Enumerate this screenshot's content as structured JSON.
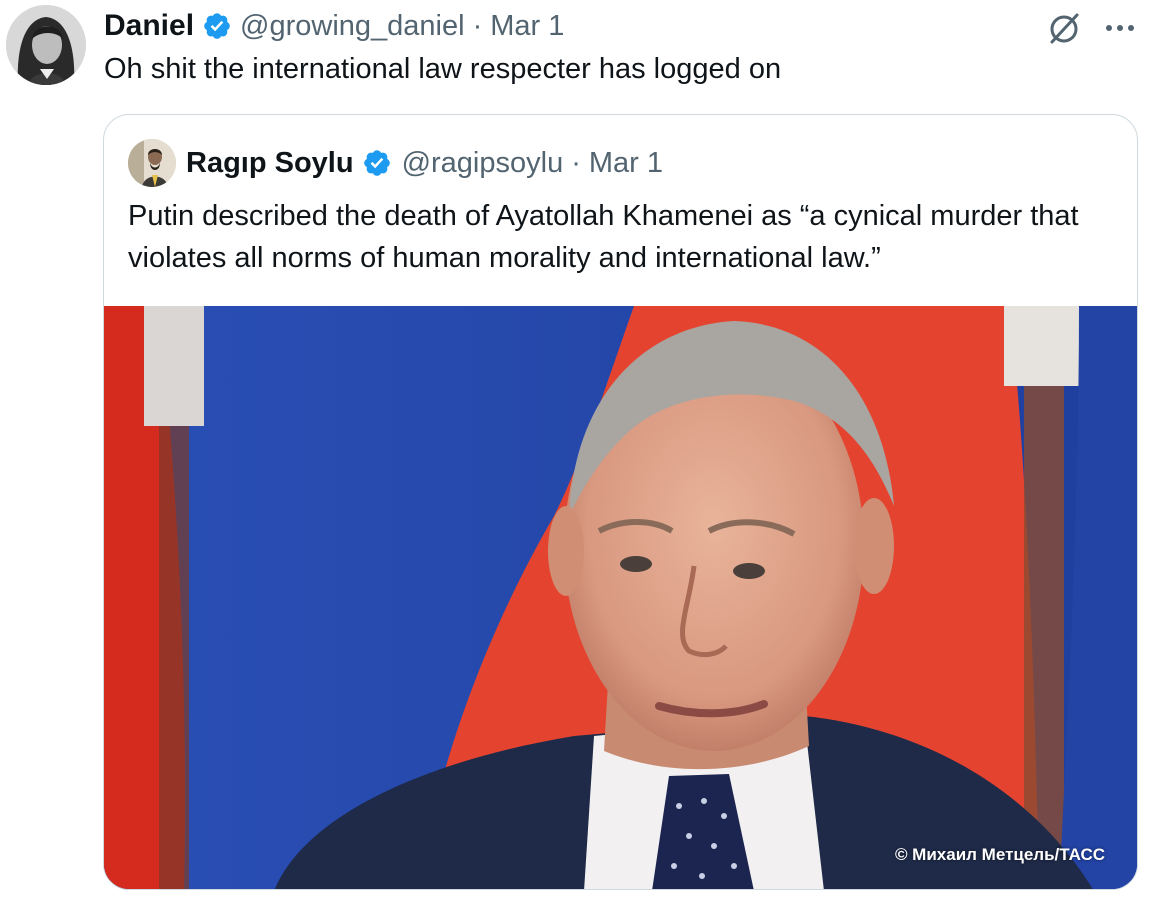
{
  "tweet": {
    "author_name": "Daniel",
    "author_handle": "@growing_daniel",
    "separator": "·",
    "date": "Mar 1",
    "text": "Oh shit the international law respecter has logged on",
    "avatar_icon": "profile-photo",
    "verified_icon": "verified-badge-icon",
    "grok_icon": "grok-icon",
    "more_icon": "more-options-icon"
  },
  "quoted": {
    "author_name": "Ragıp Soylu",
    "author_handle": "@ragipsoylu",
    "separator": "·",
    "date": "Mar 1",
    "text": "Putin described the death of Ayatollah Khamenei as “a cynical murder that violates all norms of human morality and international law.”",
    "image_credit": "©  Михаил Метцель/ТАСС"
  },
  "colors": {
    "text_primary": "#0f1419",
    "text_secondary": "#536471",
    "verified_blue": "#1d9bf0",
    "card_border": "#cfd9de"
  }
}
